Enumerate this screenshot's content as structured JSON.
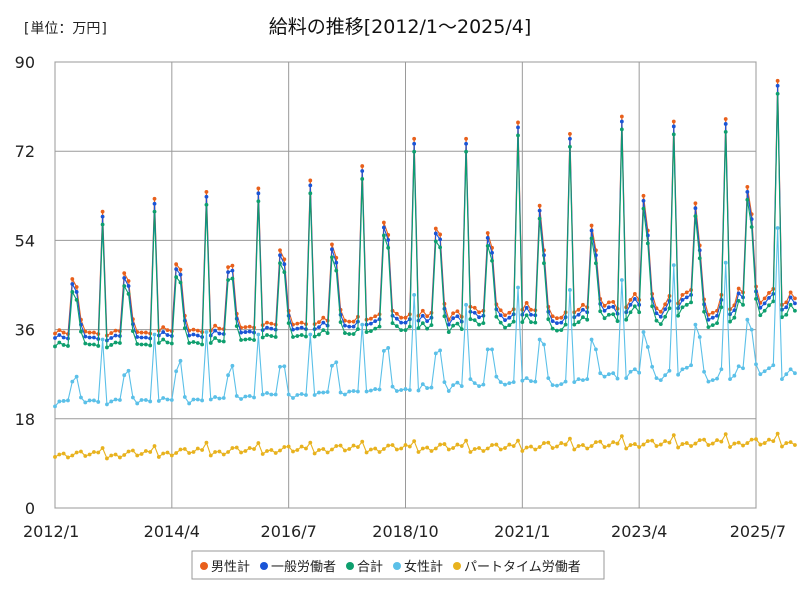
{
  "chart_data": {
    "type": "line",
    "title": "給料の推移[2012/1～2025/4]",
    "unit_label": "[単位：万円]",
    "ylim": [
      0,
      90
    ],
    "yticks": [
      0,
      18,
      36,
      54,
      72,
      90
    ],
    "xticks": [
      "2012/1",
      "2014/4",
      "2016/7",
      "2018/10",
      "2021/1",
      "2023/4",
      "2025/7"
    ],
    "x_start": "2012/1",
    "x_end": "2025/4",
    "grid": true,
    "legend_position": "bottom",
    "series": [
      {
        "name": "男性計",
        "color": "#e8601c",
        "values": [
          35.2,
          35.9,
          35.4,
          35.1,
          46.2,
          44.6,
          38,
          35.6,
          35.4,
          35.4,
          35.1,
          59.8,
          34.8,
          35.3,
          35.8,
          35.7,
          47.4,
          45.8,
          38.1,
          35.5,
          35.4,
          35.4,
          35.2,
          62.4,
          35.8,
          36.5,
          35.9,
          35.7,
          49.2,
          48.1,
          38.8,
          35.8,
          36,
          35.8,
          35.5,
          63.8,
          35.8,
          36.8,
          36.2,
          36.1,
          48.6,
          48.9,
          39.2,
          36.4,
          36.5,
          36.6,
          36.4,
          64.5,
          36.9,
          37.4,
          37.2,
          37,
          52,
          50.2,
          39.8,
          37,
          37.2,
          37.4,
          37.1,
          66.1,
          37.1,
          37.5,
          38.4,
          37.8,
          53.2,
          50.5,
          40,
          37.8,
          37.6,
          37.6,
          38.6,
          69,
          38,
          38.2,
          38.7,
          39.1,
          57.6,
          55.1,
          39.8,
          39.2,
          38.4,
          38.4,
          39.1,
          74.5,
          38.8,
          39.8,
          38.7,
          39.4,
          56.4,
          55.2,
          41.2,
          38,
          39.3,
          39.7,
          38.6,
          74.5,
          40.6,
          40.4,
          39.5,
          39.8,
          55.5,
          52.5,
          41.1,
          39.9,
          38.9,
          39.4,
          40.1,
          77.8,
          40,
          41.4,
          40,
          39.9,
          61,
          52,
          40.6,
          38.7,
          38.3,
          38.4,
          39.5,
          75.5,
          39.5,
          40,
          41,
          40.5,
          57,
          52,
          42.2,
          40.8,
          41.5,
          41.6,
          40.2,
          79,
          40.5,
          42,
          43.2,
          42,
          63,
          56,
          43.2,
          40.3,
          39.6,
          41.1,
          42.8,
          78,
          41.3,
          43,
          43.5,
          44,
          61.5,
          53,
          42.1,
          39,
          39.4,
          39.8,
          43,
          78.5,
          40.1,
          40.9,
          44.3,
          43.5,
          64.8,
          59.3,
          44.7,
          41.4,
          42.3,
          43.4,
          44.2,
          86.2,
          41,
          41.5,
          43.5,
          42.3
        ]
      },
      {
        "name": "一般労働者",
        "color": "#1a55d6",
        "values": [
          34.3,
          34.9,
          34.4,
          34.2,
          45.2,
          43.6,
          37,
          34.6,
          34.4,
          34.4,
          34.1,
          58.8,
          33.8,
          34.3,
          34.8,
          34.7,
          46.4,
          44.8,
          37.1,
          34.5,
          34.4,
          34.4,
          34.2,
          61.4,
          34.8,
          35.5,
          34.9,
          34.7,
          48.2,
          47.1,
          37.8,
          34.8,
          35,
          34.8,
          34.5,
          62.8,
          34.8,
          35.8,
          35.2,
          35.1,
          47.6,
          47.9,
          38.2,
          35.4,
          35.5,
          35.6,
          35.4,
          63.5,
          35.9,
          36.4,
          36.2,
          36,
          51,
          49.2,
          38.8,
          36,
          36.2,
          36.4,
          36.1,
          65.1,
          36.1,
          36.5,
          37.4,
          36.8,
          52.2,
          49.5,
          39,
          36.8,
          36.6,
          36.6,
          37.6,
          68,
          37,
          37.2,
          37.7,
          38.1,
          56.6,
          54.1,
          38.8,
          38.2,
          37.4,
          37.4,
          38.1,
          73.5,
          37.8,
          38.8,
          37.7,
          38.4,
          55.4,
          54.2,
          40.2,
          37,
          38.3,
          38.7,
          37.6,
          73.5,
          39.6,
          39.4,
          38.5,
          38.8,
          54.5,
          51.5,
          40.1,
          38.9,
          37.9,
          38.4,
          39.1,
          76.8,
          39,
          40.4,
          39,
          38.9,
          60,
          51,
          39.6,
          37.7,
          37.3,
          37.4,
          38.5,
          74.5,
          38.5,
          39,
          40,
          39.5,
          56,
          51,
          41.2,
          39.8,
          40.5,
          40.6,
          39.2,
          78,
          39.5,
          41,
          42.2,
          41,
          62,
          55,
          42.2,
          39.3,
          38.6,
          40.1,
          41.8,
          77,
          40.3,
          42,
          42.5,
          43,
          60.5,
          52,
          41.1,
          38,
          38.4,
          38.8,
          42,
          77.5,
          39.1,
          39.9,
          43.3,
          42.5,
          63.8,
          58.3,
          43.7,
          40.4,
          41.3,
          42.4,
          43.2,
          85.2,
          40,
          40.5,
          42.5,
          41.3
        ]
      },
      {
        "name": "合計",
        "color": "#0e9f6e",
        "values": [
          32.6,
          33.4,
          32.9,
          32.7,
          43.6,
          42,
          35.6,
          33.2,
          33,
          33,
          32.7,
          57.2,
          32.4,
          32.9,
          33.4,
          33.3,
          44.8,
          43.2,
          35.7,
          33.1,
          33,
          33,
          32.8,
          59.8,
          33.3,
          34,
          33.4,
          33.2,
          46.6,
          45.5,
          36.3,
          33.3,
          33.5,
          33.3,
          33,
          61.2,
          33.3,
          34.3,
          33.7,
          33.6,
          46,
          46.3,
          36.7,
          33.9,
          34,
          34.1,
          33.9,
          61.9,
          34.4,
          34.9,
          34.7,
          34.5,
          49.4,
          47.6,
          37.3,
          34.5,
          34.7,
          34.9,
          34.6,
          63.5,
          34.6,
          35,
          35.9,
          35.3,
          50.6,
          47.9,
          37.5,
          35.3,
          35.1,
          35.1,
          36.1,
          66.4,
          35.5,
          35.7,
          36.2,
          36.6,
          55,
          52.5,
          37.3,
          36.7,
          35.9,
          35.9,
          36.6,
          71.9,
          36.3,
          37.3,
          36.2,
          36.9,
          53.8,
          52.6,
          38.7,
          35.5,
          36.8,
          37.2,
          36.1,
          71.9,
          38.1,
          37.9,
          37,
          37.3,
          52.9,
          49.9,
          38.6,
          37.4,
          36.4,
          36.9,
          37.6,
          75.2,
          37.5,
          38.9,
          37.5,
          37.4,
          58.4,
          49.4,
          38.1,
          36.2,
          35.8,
          35.9,
          37,
          72.9,
          37,
          37.5,
          38.5,
          38,
          54.4,
          49.4,
          39.7,
          38.3,
          39,
          39.1,
          37.7,
          76.4,
          38,
          39.5,
          40.7,
          39.5,
          60.4,
          53.4,
          40.7,
          37.8,
          37.1,
          38.6,
          40.3,
          75.4,
          38.8,
          40.5,
          41,
          41.5,
          58.9,
          50.4,
          39.6,
          36.5,
          36.9,
          37.3,
          40.5,
          75.9,
          37.6,
          38.4,
          41.8,
          41,
          62.2,
          56.7,
          42.2,
          38.9,
          39.8,
          40.9,
          41.7,
          83.6,
          38.5,
          39,
          41,
          39.8
        ]
      },
      {
        "name": "女性計",
        "color": "#5bc0e8",
        "values": [
          20.5,
          21.5,
          21.6,
          21.7,
          25.5,
          26.5,
          22.3,
          21.3,
          21.7,
          21.7,
          21.4,
          34,
          20.9,
          21.5,
          21.9,
          21.8,
          26.8,
          27.7,
          22.3,
          21.1,
          21.8,
          21.8,
          21.5,
          35,
          21.6,
          22.2,
          21.9,
          21.8,
          27.6,
          29.7,
          22.4,
          21.1,
          21.9,
          21.9,
          21.7,
          35.5,
          21.9,
          22.4,
          22.1,
          22.2,
          26.8,
          28.7,
          22.6,
          22,
          22.5,
          22.6,
          22.3,
          35,
          22.9,
          23.2,
          22.9,
          22.9,
          28.5,
          28.6,
          22.9,
          22.2,
          22.8,
          23,
          22.8,
          35,
          22.8,
          23.3,
          23.3,
          23.4,
          28.7,
          29.4,
          23.3,
          22.9,
          23.5,
          23.6,
          23.5,
          37,
          23.5,
          23.7,
          24,
          23.9,
          31.7,
          32.3,
          24.5,
          23.6,
          23.8,
          24,
          23.8,
          43,
          23.7,
          25,
          24.2,
          24.3,
          31.2,
          31.8,
          25.4,
          23.6,
          24.8,
          25.3,
          24.6,
          41,
          26,
          25.2,
          24.6,
          24.9,
          32,
          32,
          26.5,
          25.4,
          24.9,
          25.2,
          25.4,
          44.5,
          25.7,
          26.2,
          25.6,
          25.5,
          34,
          33,
          26.2,
          24.8,
          24.7,
          25,
          25.5,
          44,
          25.4,
          26,
          25.8,
          26,
          34,
          32,
          27.2,
          26.5,
          27,
          27.2,
          26.1,
          46,
          26.2,
          27.5,
          28,
          27.3,
          35.5,
          32.5,
          28.5,
          26.2,
          25.8,
          26.8,
          27.7,
          49,
          26.9,
          28,
          28.3,
          28.8,
          37,
          34.5,
          27.5,
          25.5,
          25.8,
          26.1,
          28,
          49.5,
          26,
          26.7,
          28.6,
          28.2,
          38,
          36,
          29,
          27,
          27.6,
          28.2,
          28.8,
          56.5,
          26,
          27,
          28,
          27.2
        ]
      },
      {
        "name": "パートタイム労働者",
        "color": "#e8b21e",
        "values": [
          10.3,
          10.8,
          11,
          10.2,
          10.6,
          11.2,
          11.4,
          10.5,
          10.8,
          11.3,
          11.2,
          12.1,
          10,
          10.6,
          10.8,
          10.2,
          10.7,
          11.4,
          11.6,
          10.6,
          10.9,
          11.5,
          11.3,
          12.5,
          10.3,
          11,
          11.2,
          10.6,
          11.1,
          11.8,
          11.9,
          11.1,
          11.3,
          12,
          11.7,
          13.2,
          10.6,
          11.3,
          11.4,
          10.8,
          11.3,
          12.1,
          12.2,
          11.2,
          11.5,
          12.1,
          11.9,
          13.1,
          10.9,
          11.5,
          11.7,
          11.1,
          11.6,
          12.3,
          12.4,
          11.4,
          11.7,
          12.4,
          12,
          13.2,
          11,
          11.7,
          11.9,
          11.2,
          11.8,
          12.5,
          12.6,
          11.6,
          11.9,
          12.6,
          12.3,
          13.4,
          11.2,
          11.8,
          12,
          11.3,
          11.9,
          12.6,
          12.7,
          11.8,
          12,
          12.7,
          12.4,
          13.5,
          11.3,
          12,
          12.2,
          11.5,
          12,
          12.8,
          12.9,
          11.8,
          12.1,
          12.8,
          12.5,
          13.6,
          11.3,
          11.9,
          12.1,
          11.5,
          12,
          12.7,
          12.8,
          11.8,
          12.1,
          12.8,
          12.5,
          13.6,
          11.5,
          12.2,
          12.4,
          11.8,
          12.3,
          13.1,
          13.2,
          12.1,
          12.4,
          13.1,
          12.8,
          14,
          11.8,
          12.5,
          12.7,
          12,
          12.5,
          13.3,
          13.4,
          12.3,
          12.6,
          13.3,
          13,
          14.5,
          12,
          12.7,
          12.9,
          12.3,
          12.8,
          13.5,
          13.6,
          12.5,
          12.8,
          13.5,
          13.2,
          14.7,
          12.2,
          12.9,
          13.1,
          12.5,
          13,
          13.7,
          13.8,
          12.7,
          13,
          13.7,
          13.4,
          14.9,
          12.3,
          13,
          13.2,
          12.6,
          13.1,
          13.8,
          13.9,
          12.8,
          13.1,
          13.8,
          13.5,
          15,
          12.4,
          13.1,
          13.3,
          12.7
        ]
      }
    ]
  }
}
